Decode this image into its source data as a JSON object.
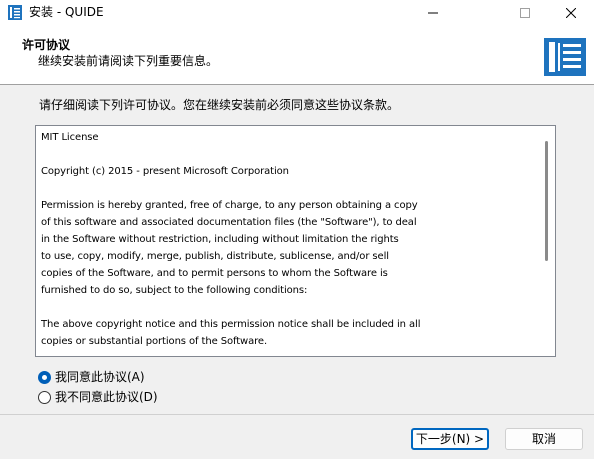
{
  "window": {
    "title": "安装 - QUIDE",
    "app_icon": "book-icon"
  },
  "header": {
    "title": "许可协议",
    "subtitle": "继续安装前请阅读下列重要信息。",
    "logo": "book-logo-icon"
  },
  "instruction": "请仔细阅读下列许可协议。您在继续安装前必须同意这些协议条款。",
  "license": {
    "text": "MIT License\n\nCopyright (c) 2015 - present Microsoft Corporation\n\nPermission is hereby granted, free of charge, to any person obtaining a copy\nof this software and associated documentation files (the \"Software\"), to deal\nin the Software without restriction, including without limitation the rights\nto use, copy, modify, merge, publish, distribute, sublicense, and/or sell\ncopies of the Software, and to permit persons to whom the Software is\nfurnished to do so, subject to the following conditions:\n\nThe above copyright notice and this permission notice shall be included in all\ncopies or substantial portions of the Software."
  },
  "radios": {
    "accept_label": "我同意此协议(A)",
    "decline_label": "我不同意此协议(D)",
    "selected": "accept"
  },
  "buttons": {
    "next_label": "下一步(N) >",
    "cancel_label": "取消"
  },
  "colors": {
    "accent": "#0067c0",
    "logo_blue": "#1e73be"
  }
}
